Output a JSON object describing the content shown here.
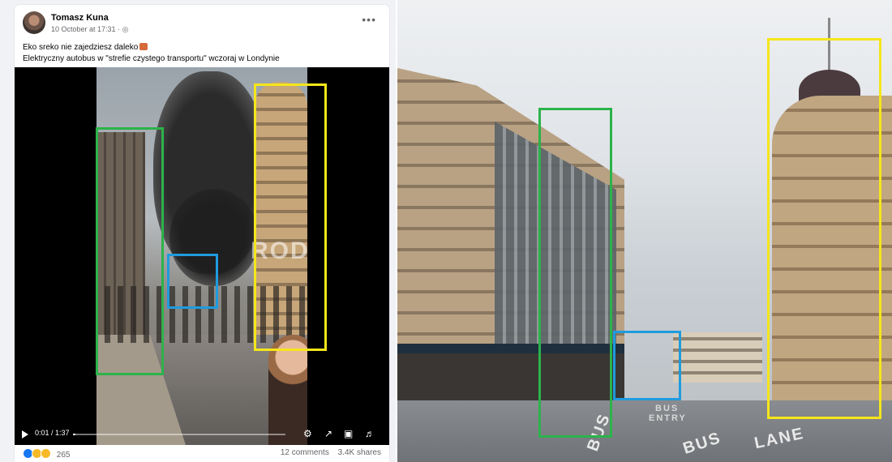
{
  "post": {
    "author": "Tomasz Kuna",
    "meta": "10 October at 17:31 · ",
    "globe_icon": "globe-icon",
    "more_icon": "more-options-icon",
    "text_line1": "Eko sreko nie zajedziesz daleko",
    "text_line2": "Elektryczny autobus w \"strefie czystego transportu\" wczoraj w Londynie",
    "video": {
      "watermark": "ROD",
      "time_label": "0:01 / 1:37",
      "progress": 0.01,
      "icons": [
        "play-icon",
        "gear-icon",
        "fullscreen-icon",
        "pip-icon",
        "volume-icon"
      ]
    },
    "footer": {
      "reaction_icons": [
        "like-icon",
        "wow-icon",
        "haha-icon"
      ],
      "reaction_count": "265",
      "comments": "12 comments",
      "shares": "3.4K shares"
    }
  },
  "photo": {
    "markings": [
      "BUS",
      "BUS",
      "ENTRY",
      "BUS",
      "LANE"
    ]
  },
  "colors": {
    "green_box": "#2cb34a",
    "blue_box": "#1f9bde",
    "yellow_box": "#f5e61a",
    "page_bg": "#f0f2f5",
    "like_blue": "#1877f2",
    "reaction_yellow": "#f7b928"
  }
}
